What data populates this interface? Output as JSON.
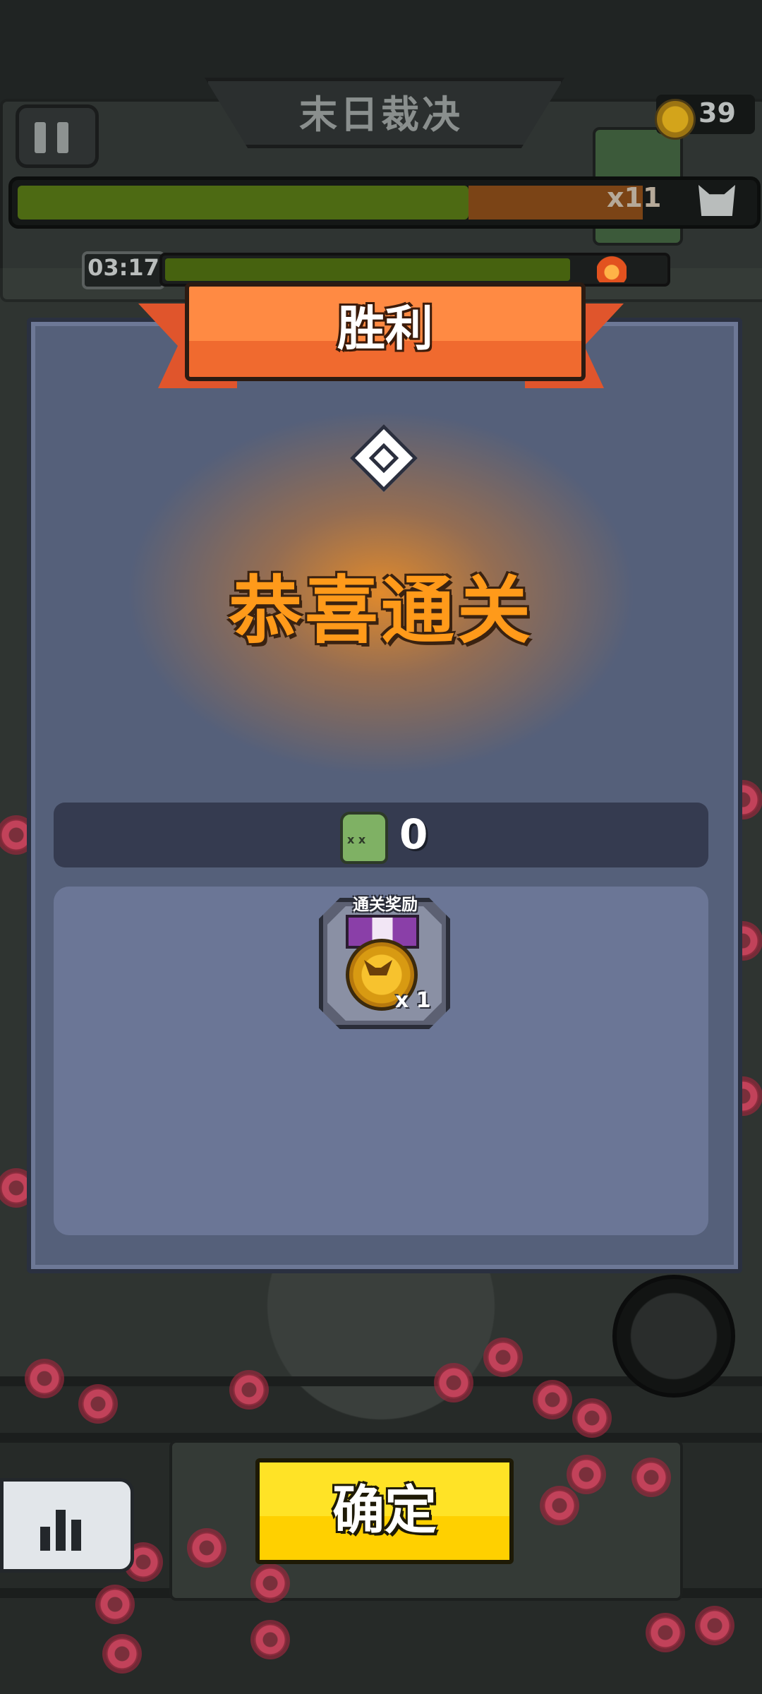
{
  "hud": {
    "level_title": "末日裁决",
    "medal_count": "39",
    "boss_multiplier": "x11",
    "timer": "03:17",
    "boss_health_fraction": 0.62,
    "boss_orange_fraction": 0.24,
    "time_progress_fraction": 0.82
  },
  "dialog": {
    "header": "胜利",
    "headline": "恭喜通关",
    "kill_count": "0",
    "reward_label": "通关奖励",
    "reward_quantity": "x 1",
    "reward_icon": "medal-icon",
    "zombie_icon_text": "x x"
  },
  "actions": {
    "confirm_label": "确定",
    "stats_icon": "bar-chart-icon",
    "pause_icon": "pause-icon"
  },
  "colors": {
    "dialog_bg": "#55607a",
    "ribbon": "#f06a2f",
    "headline": "#ff9a1a",
    "confirm": "#ffd000"
  }
}
